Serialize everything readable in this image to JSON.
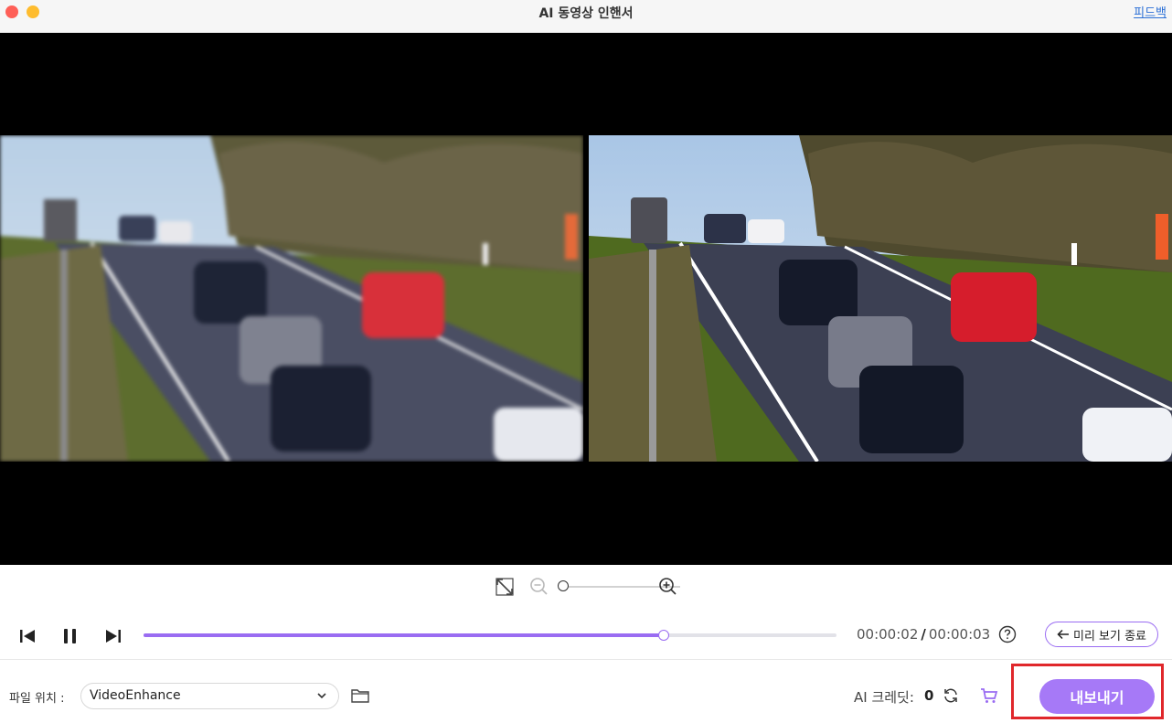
{
  "window": {
    "title": "AI 동영상 인핸서",
    "feedback_label": "피드백"
  },
  "preview": {
    "original_label": "",
    "enhanced_label": ""
  },
  "zoom": {
    "fit_icon": "fit-screen-icon",
    "zoom_out_icon": "zoom-out-icon",
    "zoom_in_icon": "zoom-in-icon",
    "level_fraction": 0.0
  },
  "playback": {
    "current_time": "00:00:02",
    "separator": "/",
    "total_time": "00:00:03",
    "progress_fraction": 0.75,
    "exit_preview_label": "미리 보기 종료",
    "icons": [
      "previous-frame-icon",
      "pause-icon",
      "next-frame-icon",
      "help-icon",
      "back-arrow-icon"
    ]
  },
  "bottom": {
    "location_label": "파일 위치 :",
    "location_value": "VideoEnhance",
    "credits_label": "AI 크레딧:",
    "credits_value": "0",
    "export_label": "내보내기"
  },
  "colors": {
    "accent": "#a679f7",
    "progress": "#9a6cf2",
    "highlight_border": "#e0272b",
    "traffic_close": "#fe5f57",
    "traffic_min": "#febc2e",
    "link": "#2b6fd6"
  }
}
